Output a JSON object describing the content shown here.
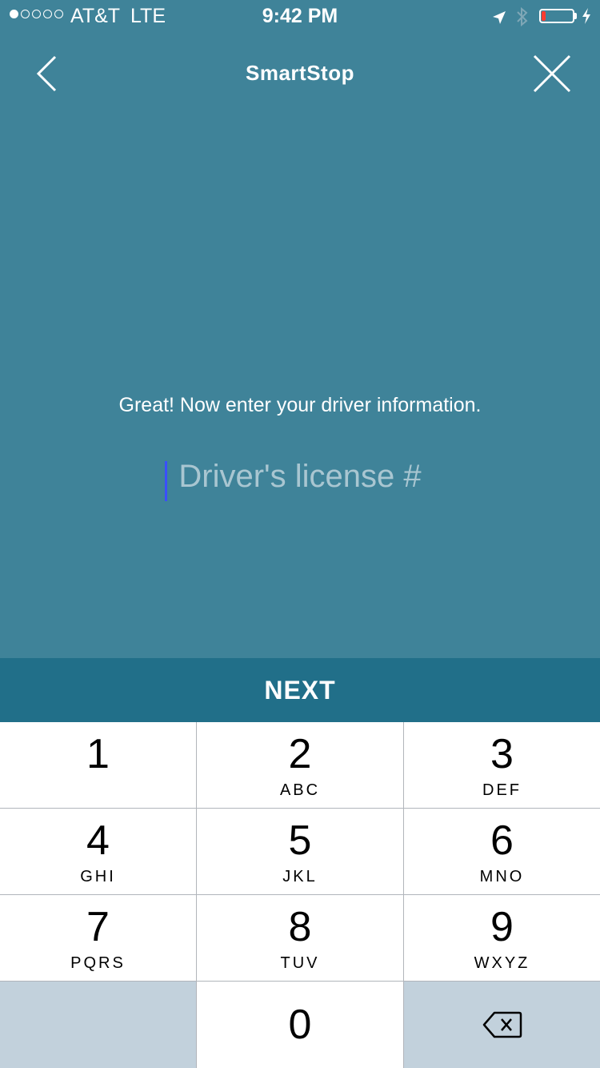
{
  "status_bar": {
    "signal_dots": [
      true,
      false,
      false,
      false,
      false
    ],
    "carrier": "AT&T",
    "network": "LTE",
    "time": "9:42 PM",
    "battery_level": 0.12,
    "battery_color": "#ff3b30"
  },
  "nav": {
    "back_icon": "chevron-left-icon",
    "title": "SmartStop",
    "close_icon": "close-icon"
  },
  "form": {
    "prompt": "Great! Now enter your driver information.",
    "license_placeholder": "Driver's license #",
    "license_value": ""
  },
  "actions": {
    "next_label": "NEXT"
  },
  "keypad": {
    "keys": [
      {
        "digit": "1",
        "letters": ""
      },
      {
        "digit": "2",
        "letters": "ABC"
      },
      {
        "digit": "3",
        "letters": "DEF"
      },
      {
        "digit": "4",
        "letters": "GHI"
      },
      {
        "digit": "5",
        "letters": "JKL"
      },
      {
        "digit": "6",
        "letters": "MNO"
      },
      {
        "digit": "7",
        "letters": "PQRS"
      },
      {
        "digit": "8",
        "letters": "TUV"
      },
      {
        "digit": "9",
        "letters": "WXYZ"
      }
    ],
    "zero": "0",
    "delete_icon": "backspace-icon"
  },
  "colors": {
    "background": "#3f8399",
    "next_bar": "#216f89",
    "keypad_gray": "#c2d1dc"
  }
}
